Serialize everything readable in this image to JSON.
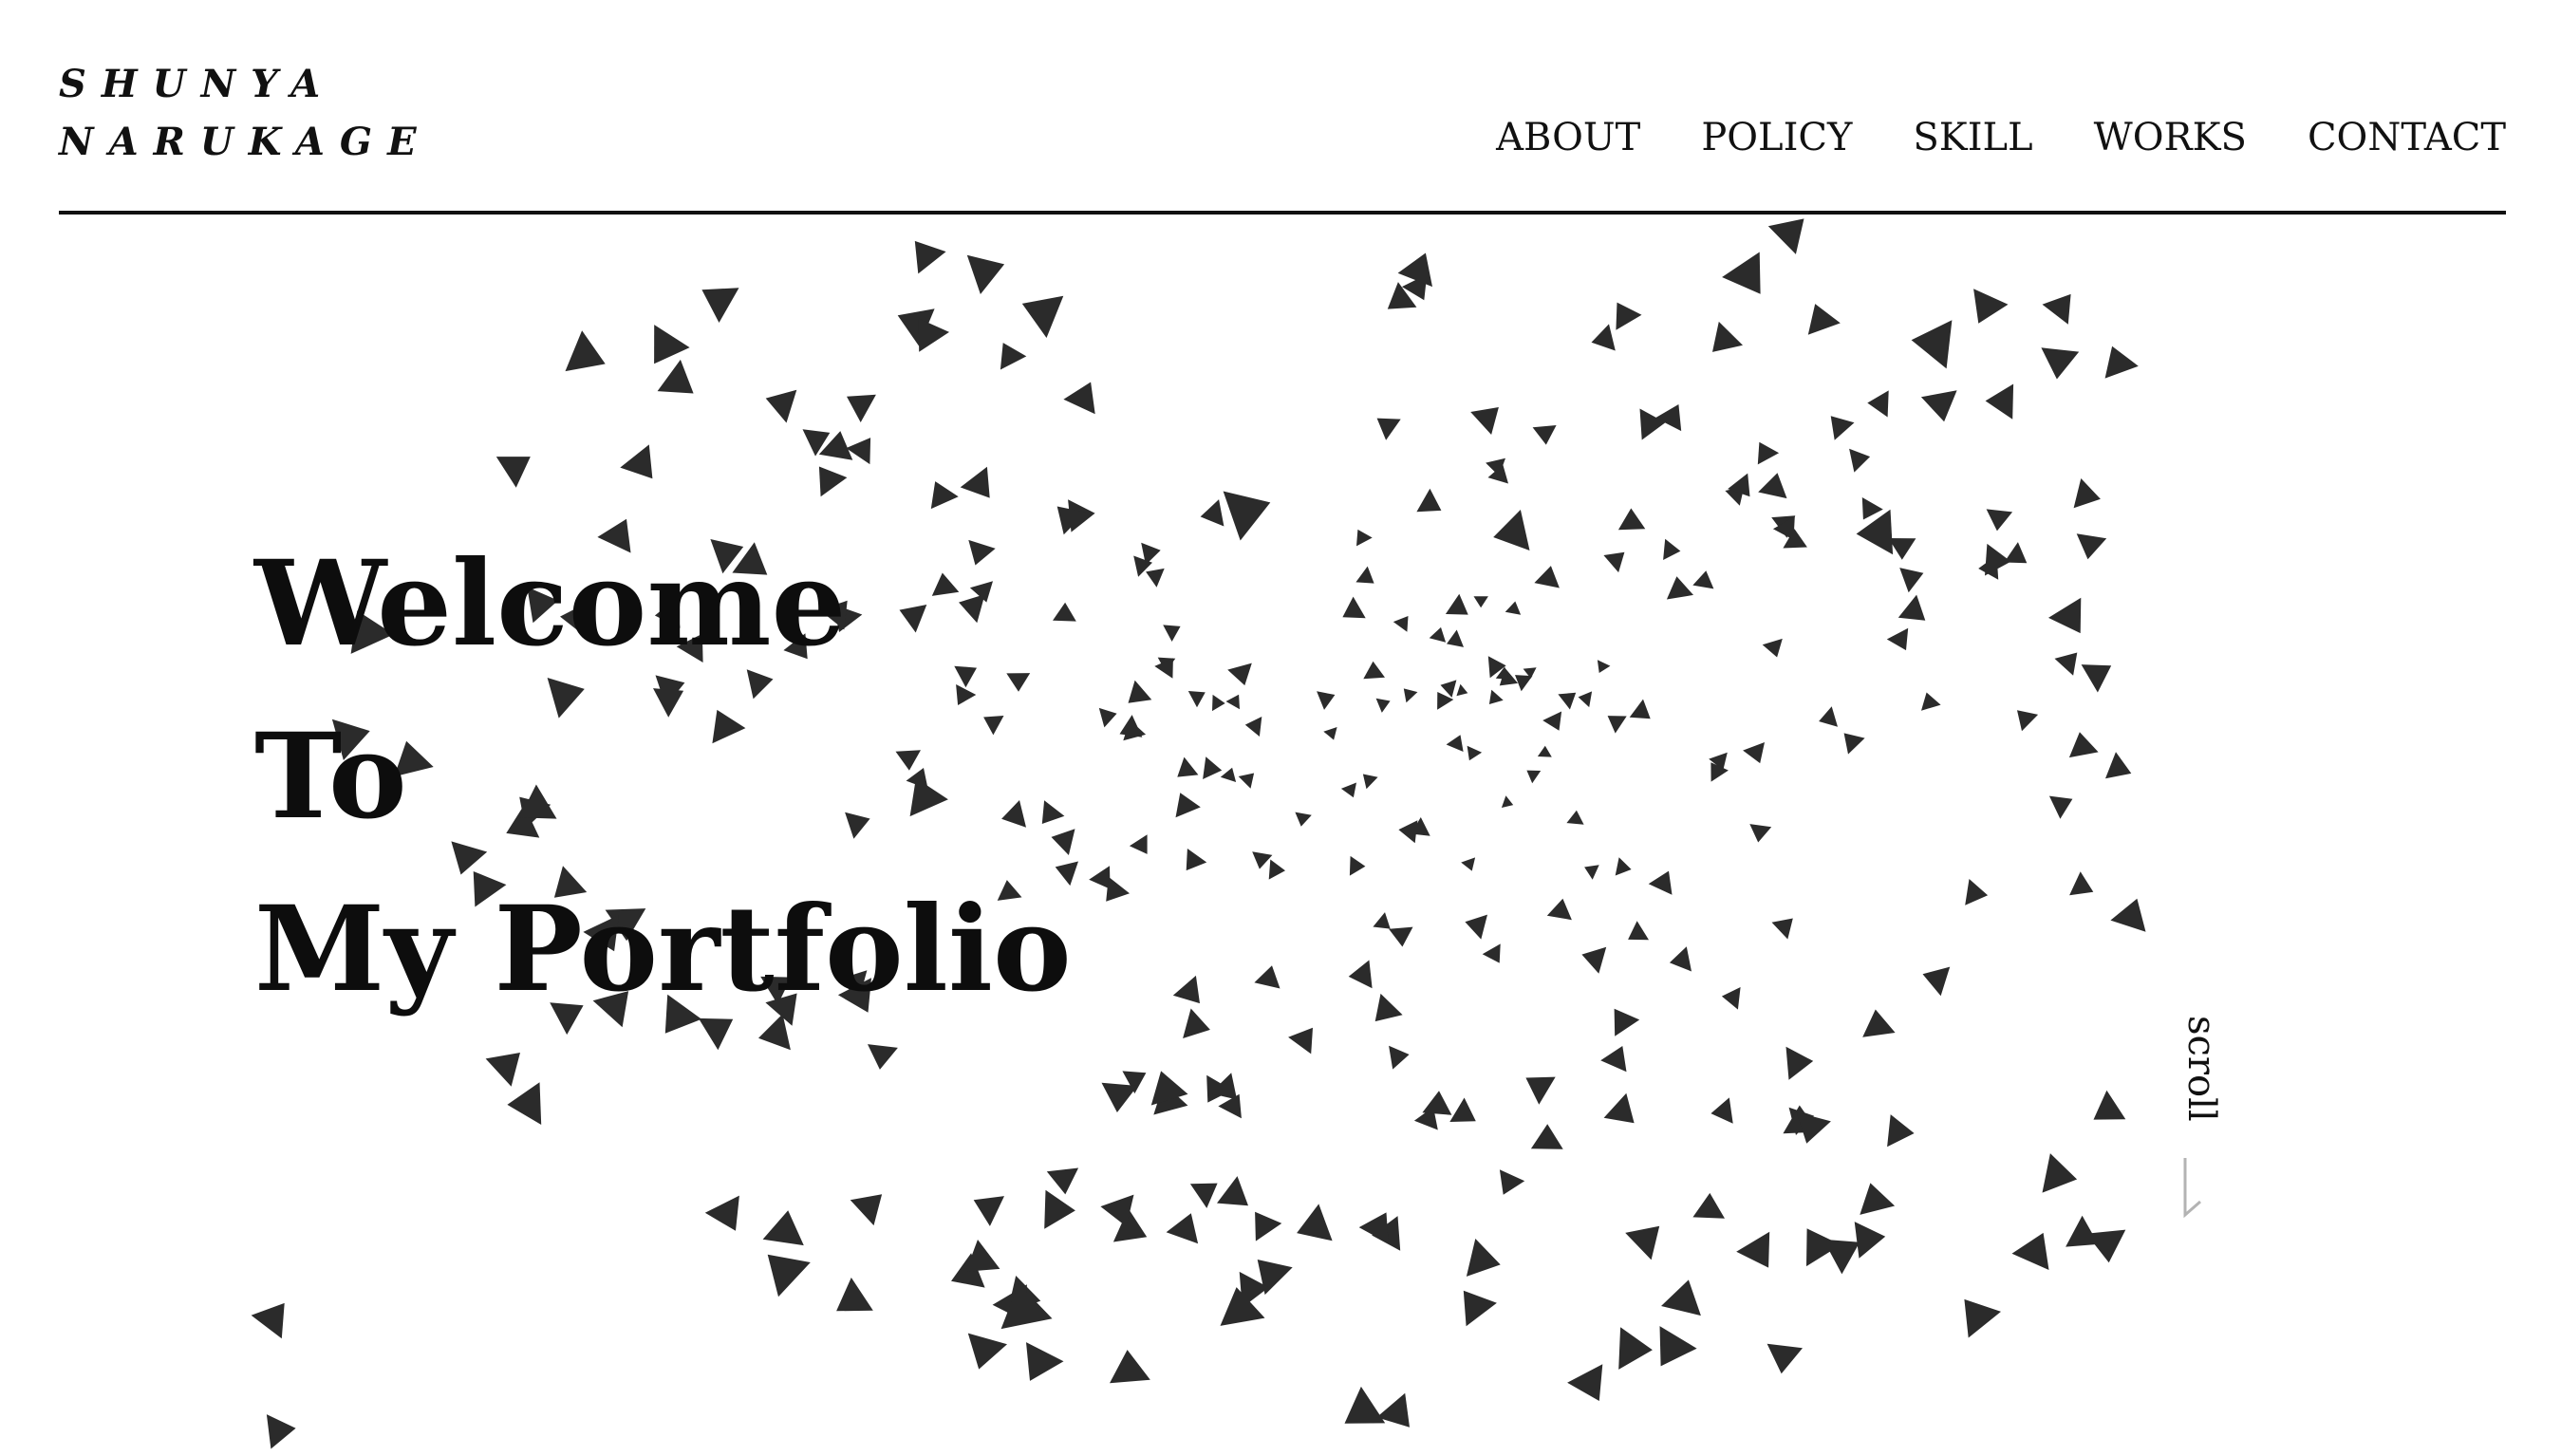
{
  "header": {
    "logo_line1": "SHUNYA",
    "logo_line2": "NARUKAGE",
    "nav": [
      "ABOUT",
      "POLICY",
      "SKILL",
      "WORKS",
      "CONTACT"
    ]
  },
  "hero": {
    "line1": "Welcome",
    "line2": "To",
    "line3": "My Portfolio"
  },
  "scroll": {
    "label": "scroll"
  },
  "colors": {
    "text": "#111111",
    "particle": "#2b2b2b",
    "scroll_arrow": "#b3b3b3",
    "background": "#ffffff"
  },
  "icons": {
    "scroll_arrow": "scroll-arrow-icon",
    "particle": "bird-triangle-icon"
  }
}
